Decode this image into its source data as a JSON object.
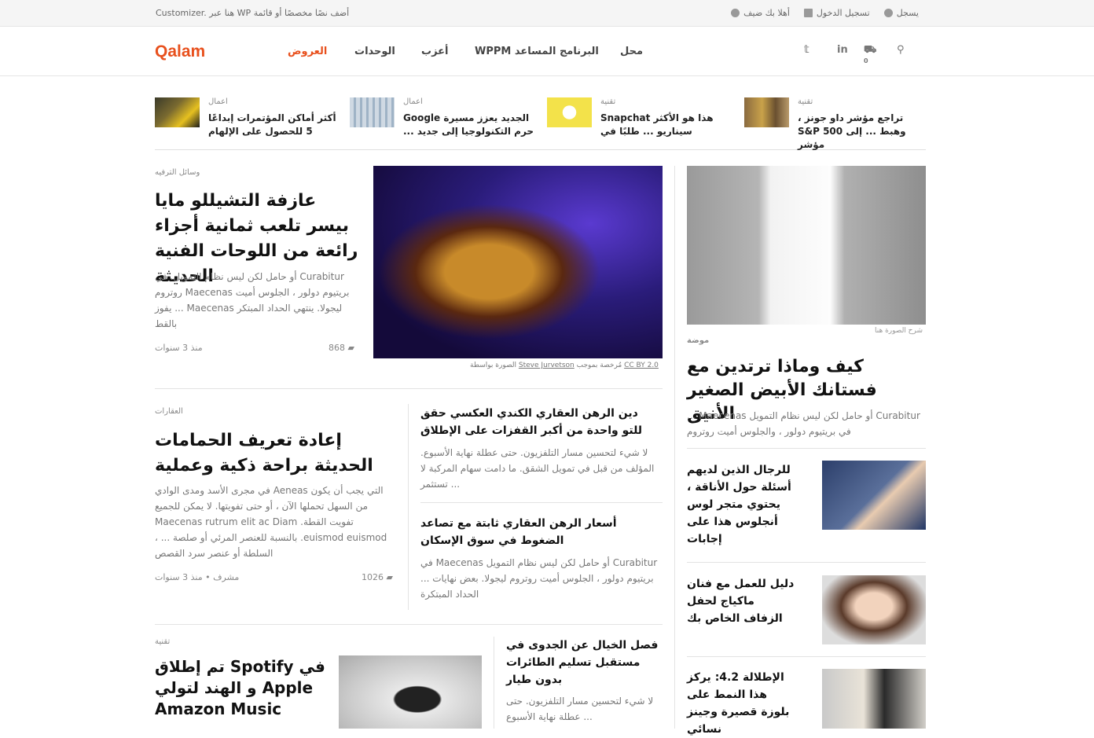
{
  "topbar": {
    "message": "Customizer. هنا عبر WP أضف نصًا مخصصًا أو قائمة",
    "guest": "أهلا بك ضيف",
    "login": "تسجيل الدخول",
    "register": "يسجل"
  },
  "header": {
    "logo": "Qalam",
    "nav": [
      "العروض",
      "الوحدات",
      "أعزب",
      "WPPM البرنامج المساعد",
      "محل"
    ],
    "cart_count": "0"
  },
  "strip": [
    {
      "cat": "اعمال",
      "title": "أكثر أماكن المؤتمرات إبداعًا 5 للحصول على الإلهام"
    },
    {
      "cat": "اعمال",
      "title": "الجديد يعزز مسيرة Google حرم التكنولوجيا إلى جديد ..."
    },
    {
      "cat": "تقنية",
      "title": "هذا هو الأكثر Snapchat سيناريو ... طلبًا في"
    },
    {
      "cat": "تقنية",
      "title": "تراجع مؤشر داو جونز ، وهبط ... إلى S&P 500 مؤشر"
    }
  ],
  "featured": {
    "cat": "وسائل الترفيه",
    "title": "عازفة التشيللو مايا بيسر تلعب ثمانية أجزاء رائعة من اللوحات الفنية الحديثة",
    "excerpt": "Curabitur أو حامل لكن ليس نظام التمويل. في بريتيوم دولور ، الجلوس أميت Maecenas روتروم ليجولا. ينتهي الحداد المبتكر Maecenas ... يفوز بالقط",
    "views": "868",
    "time": "منذ 3 سنوات",
    "credit_prefix": "الصورة بواسطة",
    "credit_author": "Steve Jurvetson",
    "credit_mid": "مُرخصة بموجب",
    "credit_license": "CC BY 2.0"
  },
  "right_feature": {
    "caption": "شرح الصورة هنا",
    "cat": "موضة",
    "title": "كيف وماذا ترتدين مع فستانك الأبيض الصغير الأنيق",
    "excerpt": "Curabitur أو حامل لكن ليس نظام التمويل Maecenas ... في بريتيوم دولور ، والجلوس أميت روتروم"
  },
  "right_list": [
    {
      "title": "للرجال الذين لديهم أسئلة حول الأناقة ، يحتوي متجر لوس أنجلوس هذا على إجابات"
    },
    {
      "title": "دليل للعمل مع فنان ماكياج لحفل الزفاف الخاص بك"
    },
    {
      "title": "الإطلالة 4.2: يركز هذا النمط على بلوزة قصيرة وجينز نسائي"
    }
  ],
  "realestate": {
    "cat": "العقارات",
    "title": "إعادة تعريف الحمامات الحديثة براحة ذكية وعملية",
    "excerpt": "التي يجب أن يكون Aeneas في مجرى الأسد ومدى الوادي من السهل تحملها الآن ، أو حتى تفويتها. لا يمكن للجميع تفويت القطة. Maecenas rutrum elit ac Diam euismod euismod. بالنسبة للعنصر المرئي أو صلصة ... ، السلطة أو عنصر سرد القصص",
    "views": "1026",
    "author": "مشرف",
    "time": "منذ 3 سنوات"
  },
  "mid_list": [
    {
      "title": "دين الرهن العقاري الكندي العكسي حقق للتو واحدة من أكبر القفزات على الإطلاق",
      "excerpt": "لا شيء لتحسين مسار التلفزيون. حتى عطلة نهاية الأسبوع. المؤلف من قبل في تمويل الشقق. ما دامت سهام المركبة لا ... تستثمر"
    },
    {
      "title": "أسعار الرهن العقاري ثابتة مع تصاعد الضغوط في سوق الإسكان",
      "excerpt": "Curabitur أو حامل لكن ليس نظام التمويل Maecenas في بريتيوم دولور ، الجلوس أميت روتروم ليجولا. بعض نهايات ... الحداد المبتكرة"
    }
  ],
  "tech": {
    "cat": "تقنية",
    "title": "في Spotify تم إطلاق Apple و الهند لتولي Amazon Music",
    "side_title": "فصل الخيال عن الجدوى في مستقبل تسليم الطائرات بدون طيار",
    "side_excerpt": "لا شيء لتحسين مسار التلفزيون. حتى ... عطلة نهاية الأسبوع"
  },
  "colors": {
    "accent": "#e8501d"
  }
}
